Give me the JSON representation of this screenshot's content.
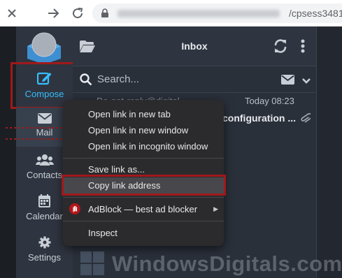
{
  "browser": {
    "url_suffix": "/cpsess3481"
  },
  "sidebar": {
    "compose_label": "Compose",
    "mail_label": "Mail",
    "contacts_label": "Contacts",
    "calendar_label": "Calendar",
    "settings_label": "Settings"
  },
  "header": {
    "title": "Inbox"
  },
  "search": {
    "placeholder": "Search..."
  },
  "message": {
    "from": "Do-not-reply@digital",
    "date": "Today 08:23",
    "subject": "configuration ..."
  },
  "context_menu": {
    "items": [
      "Open link in new tab",
      "Open link in new window",
      "Open link in incognito window",
      "Save link as...",
      "Copy link address",
      "AdBlock — best ad blocker",
      "Inspect"
    ]
  },
  "watermark": {
    "text": "WindowsDigitals.com"
  },
  "colors": {
    "accent": "#37beff",
    "highlight_border": "#a0191b",
    "sidebar_bg": "#2f3540",
    "menu_bg": "#2b2b2e"
  }
}
